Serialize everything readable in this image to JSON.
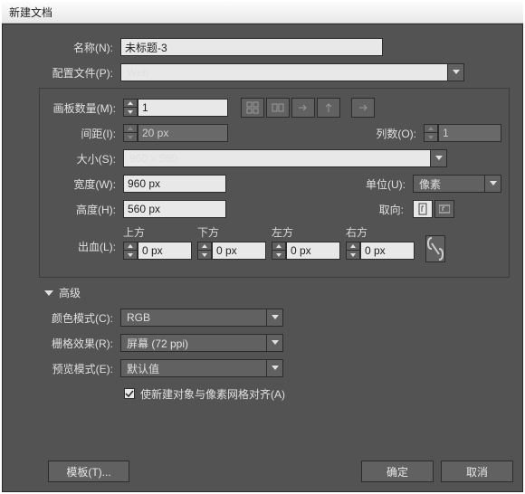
{
  "title": "新建文档",
  "labels": {
    "name": "名称(N)",
    "profile": "配置文件(P)",
    "artboards": "画板数量(M)",
    "spacing": "间距(I)",
    "columns": "列数(O)",
    "size": "大小(S)",
    "width": "宽度(W)",
    "height": "高度(H)",
    "units": "单位(U)",
    "orientation": "取向",
    "bleed": "出血(L)",
    "top": "上方",
    "bottom": "下方",
    "left": "左方",
    "right": "右方",
    "advanced": "高级",
    "colormode": "颜色模式(C)",
    "raster": "栅格效果(R)",
    "preview": "预览模式(E)",
    "align": "使新建对象与像素网格对齐(A)",
    "templates": "模板(T)...",
    "ok": "确定",
    "cancel": "取消"
  },
  "values": {
    "name": "未标题-3",
    "profile": "Web",
    "artboards": "1",
    "spacing": "20 px",
    "columns": "1",
    "size": "960 x 560",
    "width": "960 px",
    "height": "560 px",
    "units": "像素",
    "bleed_top": "0 px",
    "bleed_bottom": "0 px",
    "bleed_left": "0 px",
    "bleed_right": "0 px",
    "colormode": "RGB",
    "raster": "屏幕 (72 ppi)",
    "preview": "默认值"
  }
}
